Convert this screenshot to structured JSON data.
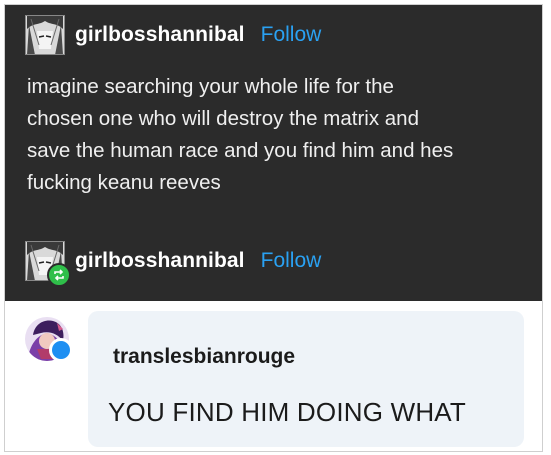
{
  "post": {
    "username": "girlbosshannibal",
    "follow_label": "Follow",
    "text_lines": [
      "imagine searching your whole life for the",
      "chosen one who will destroy the matrix and",
      "save the human race and you find him and hes",
      "fucking keanu reeves"
    ]
  },
  "reblog": {
    "username": "girlbosshannibal",
    "follow_label": "Follow"
  },
  "reply": {
    "username": "translesbianrouge",
    "text": "YOU FIND HIM DOING WHAT"
  },
  "colors": {
    "dark_bg": "#2b2b2b",
    "follow_blue": "#2aa1f2",
    "reblog_green": "#2fbf4a",
    "reply_bubble": "#eef3f8"
  },
  "icons": {
    "post_avatar": "manga-portrait-avatar",
    "reblog_badge": "reblog-icon",
    "reply_avatar": "purple-character-avatar",
    "reply_badge": "blue-status-dot"
  }
}
